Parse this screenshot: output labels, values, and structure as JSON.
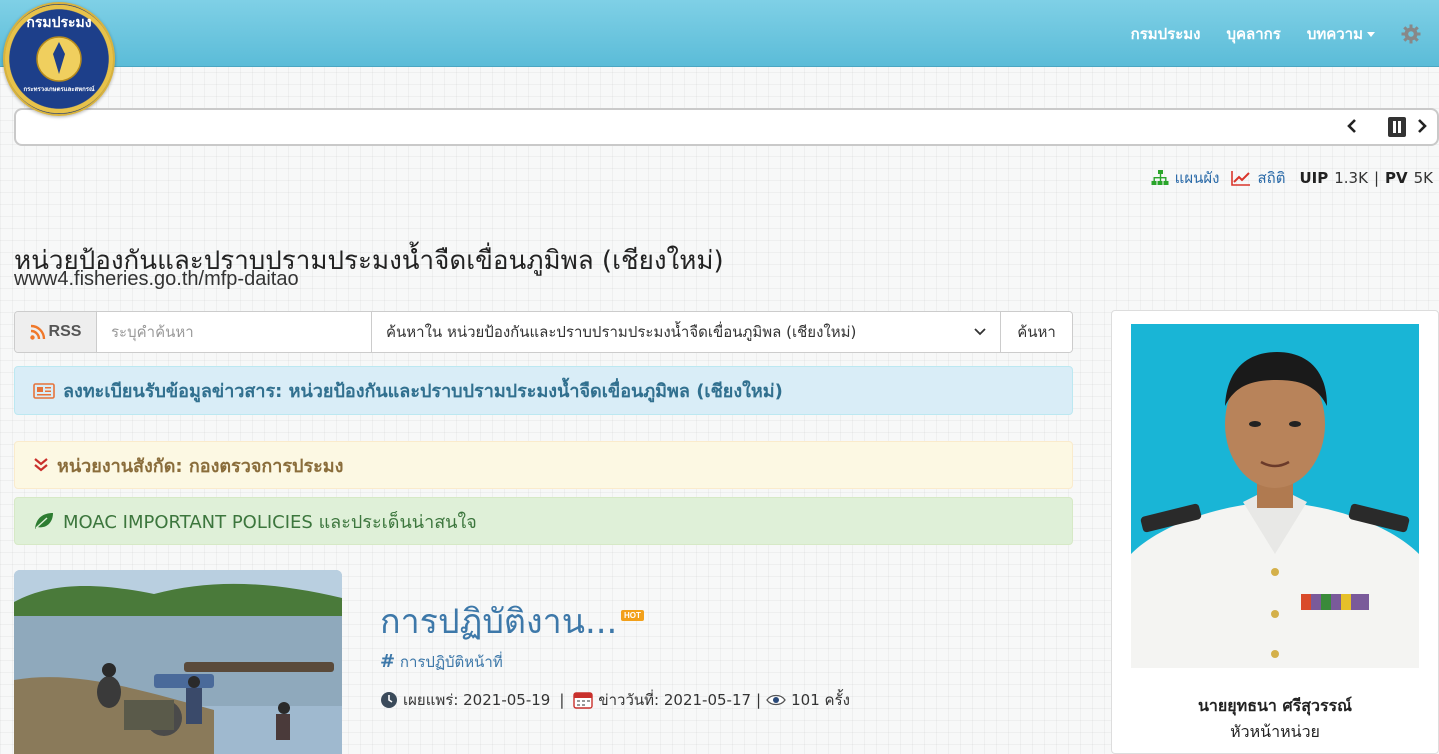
{
  "logo": {
    "text_top": "กรมประมง",
    "text_bottom": "กระทรวงเกษตรและสหกรณ์"
  },
  "nav": {
    "items": [
      "กรมประมง",
      "บุคลากร",
      "บทความ"
    ],
    "settings_icon": "gear-icon"
  },
  "ticker": {
    "prev": "‹",
    "next": "›",
    "pause_icon": "pause-icon"
  },
  "stats": {
    "sitemap_label": "แผนผัง",
    "stats_label": "สถิติ",
    "uip_label": "UIP",
    "uip_value": "1.3K",
    "separator": "|",
    "pv_label": "PV",
    "pv_value": "5K",
    "colors": {
      "sitemap": "#2aa52a",
      "stats": "#d9352b"
    }
  },
  "site": {
    "title": "หน่วยป้องกันและปราบปรามประมงน้ำจืดเขื่อนภูมิพล (เชียงใหม่)",
    "url": "www4.fisheries.go.th/mfp-daitao"
  },
  "search": {
    "rss_label": "RSS",
    "placeholder": "ระบุคำค้นหา",
    "scope_selected": "ค้นหาใน หน่วยป้องกันและปราบปรามประมงน้ำจืดเขื่อนภูมิพล (เชียงใหม่)",
    "button_label": "ค้นหา"
  },
  "alerts": {
    "subscribe": "ลงทะเบียนรับข้อมูลข่าวสาร: หน่วยป้องกันและปราบปรามประมงน้ำจืดเขื่อนภูมิพล (เชียงใหม่)",
    "parent_unit": "หน่วยงานสังกัด: กองตรวจการประมง",
    "policies": "MOAC IMPORTANT POLICIES และประเด็นน่าสนใจ"
  },
  "news": {
    "title": "การปฏิบัติงาน...",
    "hot_badge": "HOT",
    "tag": "การปฏิบัติหน้าที่",
    "published_label": "เผยแพร่: 2021-05-19",
    "news_date_label": "ข่าววันที่: 2021-05-17",
    "views_label": "101 ครั้ง",
    "sep": "|"
  },
  "profile": {
    "name": "นายยุทธนา ศรีสุวรรณ์",
    "role": "หัวหน้าหน่วย"
  }
}
